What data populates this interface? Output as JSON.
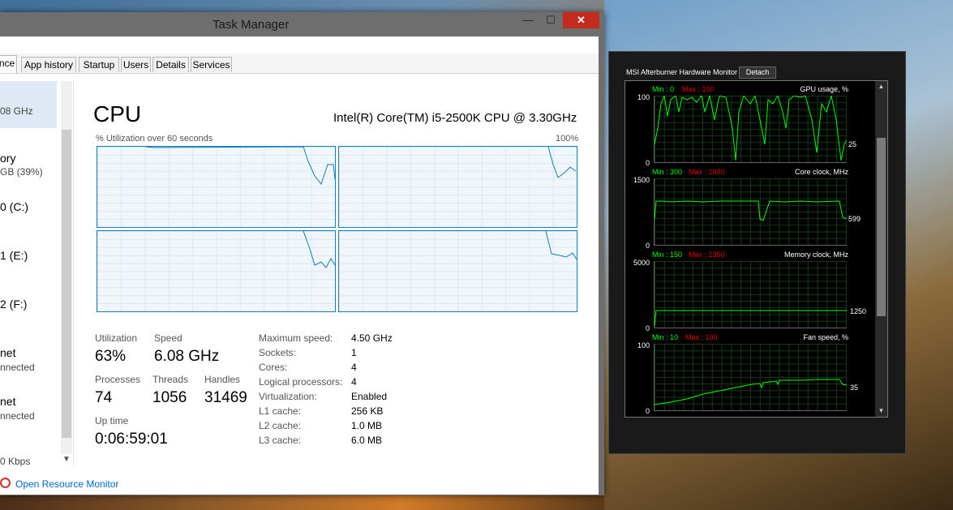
{
  "window": {
    "title": "Task Manager",
    "min_glyph": "—",
    "max_glyph": "☐",
    "close_glyph": "✕"
  },
  "tabs": [
    "nce",
    "App history",
    "Startup",
    "Users",
    "Details",
    "Services"
  ],
  "sidebar": {
    "items": [
      {
        "main": "",
        "sub": "08 GHz"
      },
      {
        "main": "ory",
        "sub": "GB (39%)"
      },
      {
        "main": "0 (C:)",
        "sub": ""
      },
      {
        "main": "1 (E:)",
        "sub": ""
      },
      {
        "main": "2 (F:)",
        "sub": ""
      },
      {
        "main": "net",
        "sub": "nnected"
      },
      {
        "main": "net",
        "sub": "nnected"
      },
      {
        "main": "",
        "sub": "0 Kbps"
      }
    ],
    "scroll_down_glyph": "▼"
  },
  "cpu": {
    "title": "CPU",
    "model": "Intel(R) Core(TM) i5-2500K CPU @ 3.30GHz",
    "graph_label": "% Utilization over 60 seconds",
    "graph_max": "100%",
    "stats": {
      "utilization_label": "Utilization",
      "utilization": "63%",
      "speed_label": "Speed",
      "speed": "6.08 GHz",
      "processes_label": "Processes",
      "processes": "74",
      "threads_label": "Threads",
      "threads": "1056",
      "handles_label": "Handles",
      "handles": "31469",
      "uptime_label": "Up time",
      "uptime": "0:06:59:01"
    },
    "details": [
      {
        "key": "Maximum speed:",
        "value": "4.50 GHz"
      },
      {
        "key": "Sockets:",
        "value": "1"
      },
      {
        "key": "Cores:",
        "value": "4"
      },
      {
        "key": "Logical processors:",
        "value": "4"
      },
      {
        "key": "Virtualization:",
        "value": "Enabled"
      },
      {
        "key": "L1 cache:",
        "value": "256 KB"
      },
      {
        "key": "L2 cache:",
        "value": "1.0 MB"
      },
      {
        "key": "L3 cache:",
        "value": "6.0 MB"
      }
    ]
  },
  "footer": {
    "link": "Open Resource Monitor"
  },
  "afterburner": {
    "title": "MSI Afterburner Hardware Monitor",
    "detach": "Detach",
    "graphs": [
      {
        "min": "Min : 0",
        "max": "Max : 100",
        "name": "GPU usage, %",
        "top": "100",
        "bottom": "0",
        "current": "25"
      },
      {
        "min": "Min : 300",
        "max": "Max : 1040",
        "name": "Core clock, MHz",
        "top": "1500",
        "bottom": "0",
        "current": "599"
      },
      {
        "min": "Min : 150",
        "max": "Max : 1350",
        "name": "Memory clock, MHz",
        "top": "5000",
        "bottom": "0",
        "current": "1250"
      },
      {
        "min": "Min : 10",
        "max": "Max : 100",
        "name": "Fan speed, %",
        "top": "100",
        "bottom": "0",
        "current": "35"
      }
    ]
  },
  "colors": {
    "cpu_graph": "#117dbb",
    "ab_line": "#00ff00",
    "ab_max": "#e00000"
  }
}
